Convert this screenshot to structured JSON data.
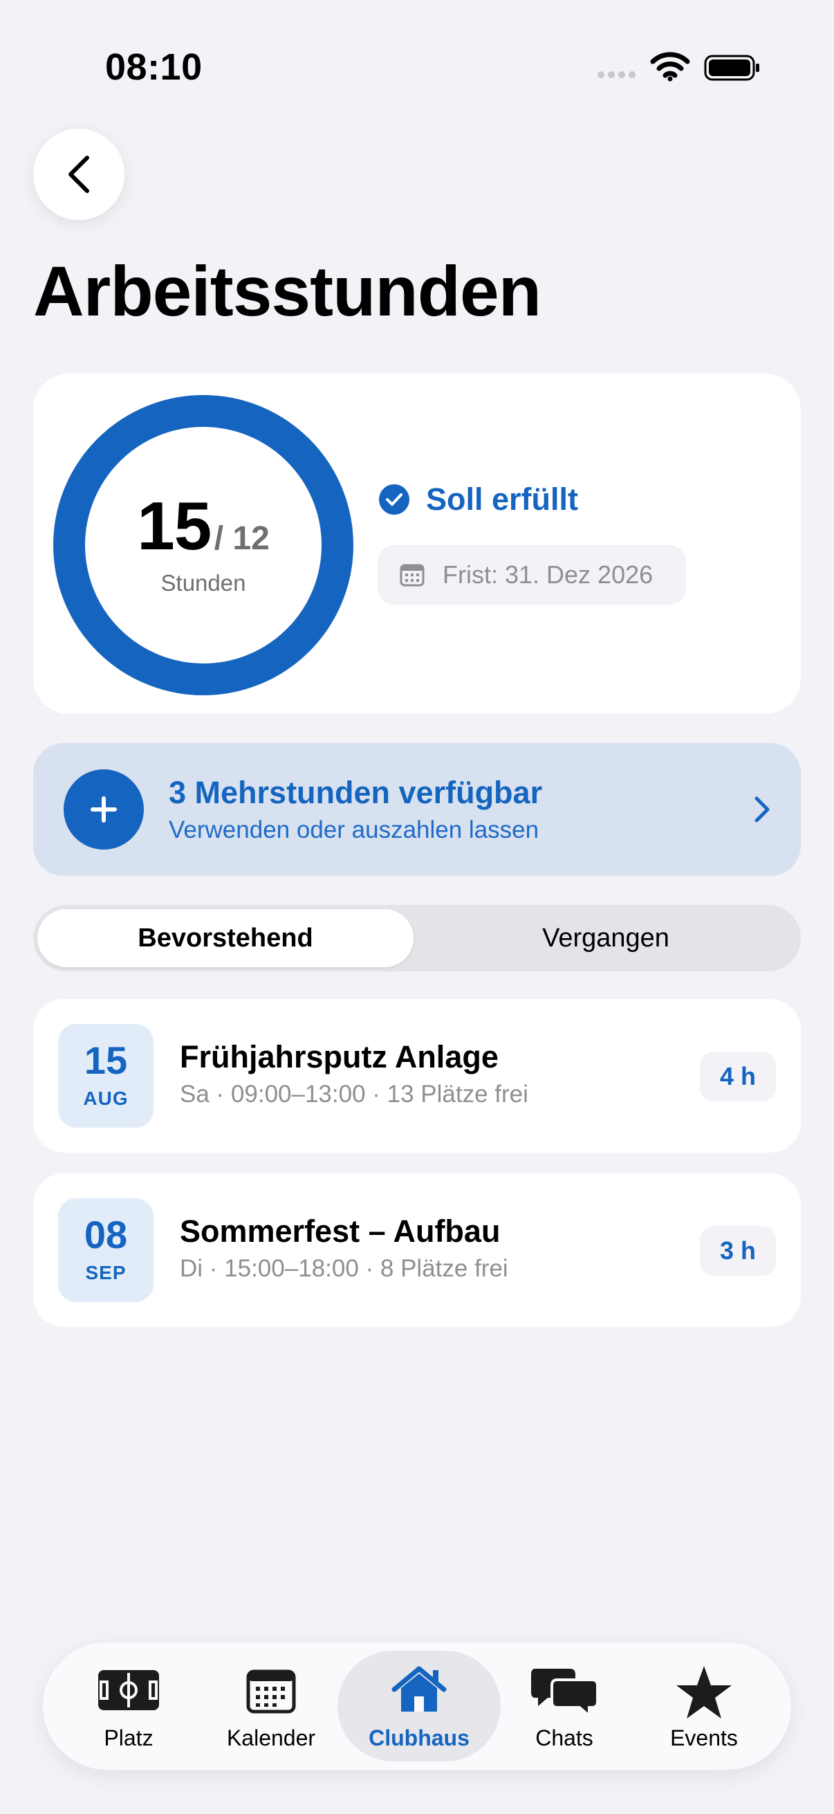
{
  "status_bar": {
    "time": "08:10"
  },
  "page": {
    "title": "Arbeitsstunden"
  },
  "summary": {
    "hours_done": "15",
    "hours_target": "/ 12",
    "hours_unit": "Stunden",
    "progress": 1.0,
    "status": "Soll erfüllt",
    "deadline": "Frist: 31. Dez 2026"
  },
  "extra_hours": {
    "title": "3 Mehrstunden verfügbar",
    "subtitle": "Verwenden oder auszahlen lassen"
  },
  "segments": {
    "upcoming": "Bevorstehend",
    "past": "Vergangen",
    "active": "upcoming"
  },
  "events": [
    {
      "day": "15",
      "month": "AUG",
      "title": "Frühjahrsputz Anlage",
      "details": "Sa · 09:00–13:00 · 13 Plätze frei",
      "hours": "4 h"
    },
    {
      "day": "08",
      "month": "SEP",
      "title": "Sommerfest – Aufbau",
      "details": "Di · 15:00–18:00 · 8 Plätze frei",
      "hours": "3 h"
    }
  ],
  "tabbar": {
    "items": [
      {
        "label": "Platz",
        "icon": "field-icon"
      },
      {
        "label": "Kalender",
        "icon": "calendar-icon"
      },
      {
        "label": "Clubhaus",
        "icon": "house-icon"
      },
      {
        "label": "Chats",
        "icon": "chat-icon"
      },
      {
        "label": "Events",
        "icon": "star-icon"
      }
    ],
    "active": "Clubhaus"
  },
  "colors": {
    "accent": "#1565C0",
    "background": "#F2F2F7",
    "card": "#FFFFFF",
    "banner": "#D8E1EF"
  }
}
